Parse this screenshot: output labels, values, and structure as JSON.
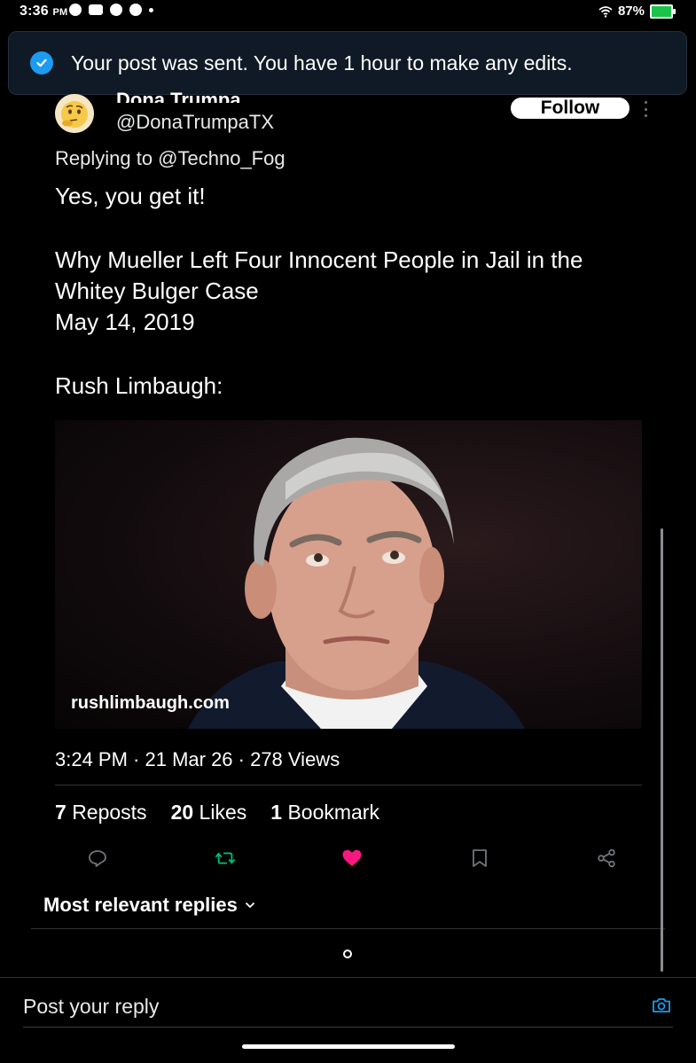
{
  "status_bar": {
    "time": "3:36",
    "ampm": "PM",
    "battery": "87%"
  },
  "toast": {
    "message": "Your post was sent. You have 1 hour to make any edits."
  },
  "post": {
    "author_name": "Dona Trumpa",
    "handle": "@DonaTrumpaTX",
    "follow_label": "Follow",
    "replying_to": "Replying to @Techno_Fog",
    "lines": [
      "Yes, you get it!",
      "Why Mueller Left Four Innocent People in Jail in the",
      "Whitey Bulger Case",
      "May 14, 2019",
      "Rush Limbaugh:"
    ],
    "image_watermark": "rushlimbaugh.com",
    "meta": "3:24 PM · 21 Mar 26 · 278 Views",
    "stats": {
      "reposts_count": "7",
      "reposts_label": "Reposts",
      "likes_count": "20",
      "likes_label": "Likes",
      "bookmarks_count": "1",
      "bookmarks_label": "Bookmark"
    },
    "liked": true
  },
  "replies": {
    "sort_label": "Most relevant replies"
  },
  "reply_box": {
    "placeholder": "Post your reply"
  },
  "colors": {
    "accent": "#1d9bf0",
    "like": "#f91880",
    "repost": "#00ba7c",
    "icon": "#71767b"
  },
  "icons": {
    "toast": "check-circle-icon",
    "reply": "reply-icon",
    "repost": "repost-icon",
    "like": "heart-icon",
    "bookmark": "bookmark-icon",
    "share": "share-icon",
    "camera": "camera-icon"
  }
}
